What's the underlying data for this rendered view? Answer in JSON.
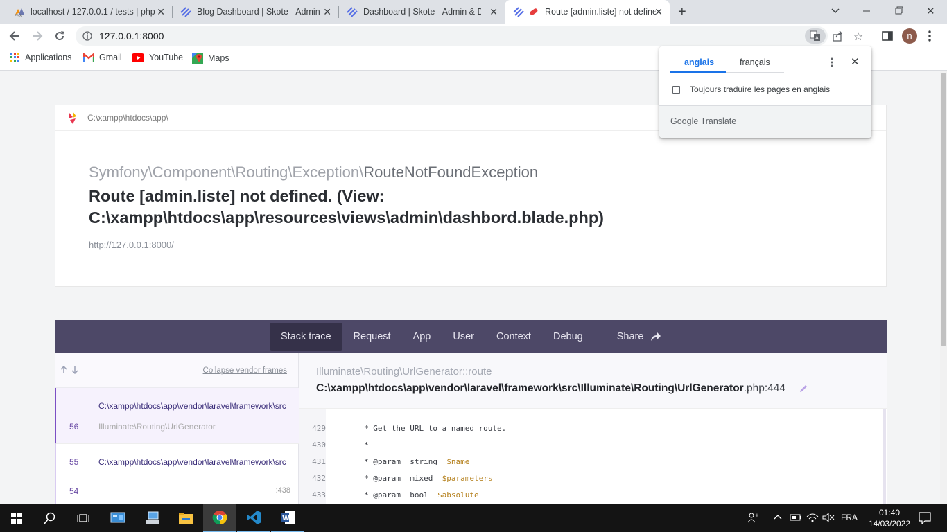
{
  "browser": {
    "tabs": [
      {
        "title": "localhost / 127.0.0.1 / tests | php",
        "favicon": "phpmyadmin-icon"
      },
      {
        "title": "Blog Dashboard | Skote - Admin",
        "favicon": "skote-icon"
      },
      {
        "title": "Dashboard | Skote - Admin & Da",
        "favicon": "skote-icon"
      },
      {
        "title": "Route [admin.liste] not define",
        "favicon": "ignition-icon",
        "active": true
      }
    ],
    "url": "127.0.0.1:8000",
    "profile_initial": "n",
    "bookmarks": [
      "Applications",
      "Gmail",
      "YouTube",
      "Maps"
    ]
  },
  "translate_popup": {
    "tab_source": "anglais",
    "tab_target": "français",
    "checkbox_label": "Toujours traduire les pages en anglais",
    "footer_brand": "Google",
    "footer_product": "Translate"
  },
  "error": {
    "app_path": "C:\\xampp\\htdocs\\app\\",
    "exception_namespace": "Symfony\\Component\\Routing\\Exception\\",
    "exception_class": "RouteNotFoundException",
    "message": "Route [admin.liste] not defined. (View: C:\\xampp\\htdocs\\app\\resources\\views\\admin\\dashbord.blade.php)",
    "url": "http://127.0.0.1:8000/"
  },
  "nav": {
    "items": [
      "Stack trace",
      "Request",
      "App",
      "User",
      "Context",
      "Debug"
    ],
    "share": "Share",
    "selected": "Stack trace"
  },
  "frames": {
    "collapse_label": "Collapse vendor frames",
    "list": [
      {
        "num": "56",
        "path": "C:\\xampp\\htdocs\\app\\vendor\\laravel\\framework\\src",
        "cls": "Illuminate\\Routing\\UrlGenerator",
        "selected": true
      },
      {
        "num": "55",
        "path": "C:\\xampp\\htdocs\\app\\vendor\\laravel\\framework\\src",
        "cls": ""
      },
      {
        "num": "54",
        "path": "",
        "line": ":438"
      }
    ]
  },
  "code": {
    "class_path": "Illuminate\\Routing\\",
    "class_name": "UrlGenerator",
    "method": "::route",
    "file": "C:\\xampp\\htdocs\\app\\vendor\\laravel\\framework\\src\\Illuminate\\Routing\\UrlGenerator",
    "file_suffix": ".php:444",
    "lines": [
      {
        "n": "429",
        "text": "* Get the URL to a named route."
      },
      {
        "n": "430",
        "text": "*"
      },
      {
        "n": "431",
        "pre": "* @param  string  ",
        "var": "$name"
      },
      {
        "n": "432",
        "pre": "* @param  mixed  ",
        "var": "$parameters"
      },
      {
        "n": "433",
        "pre": "* @param  bool  ",
        "var": "$absolute"
      }
    ]
  },
  "taskbar": {
    "time": "01:40",
    "date": "14/03/2022",
    "lang": "FRA"
  }
}
